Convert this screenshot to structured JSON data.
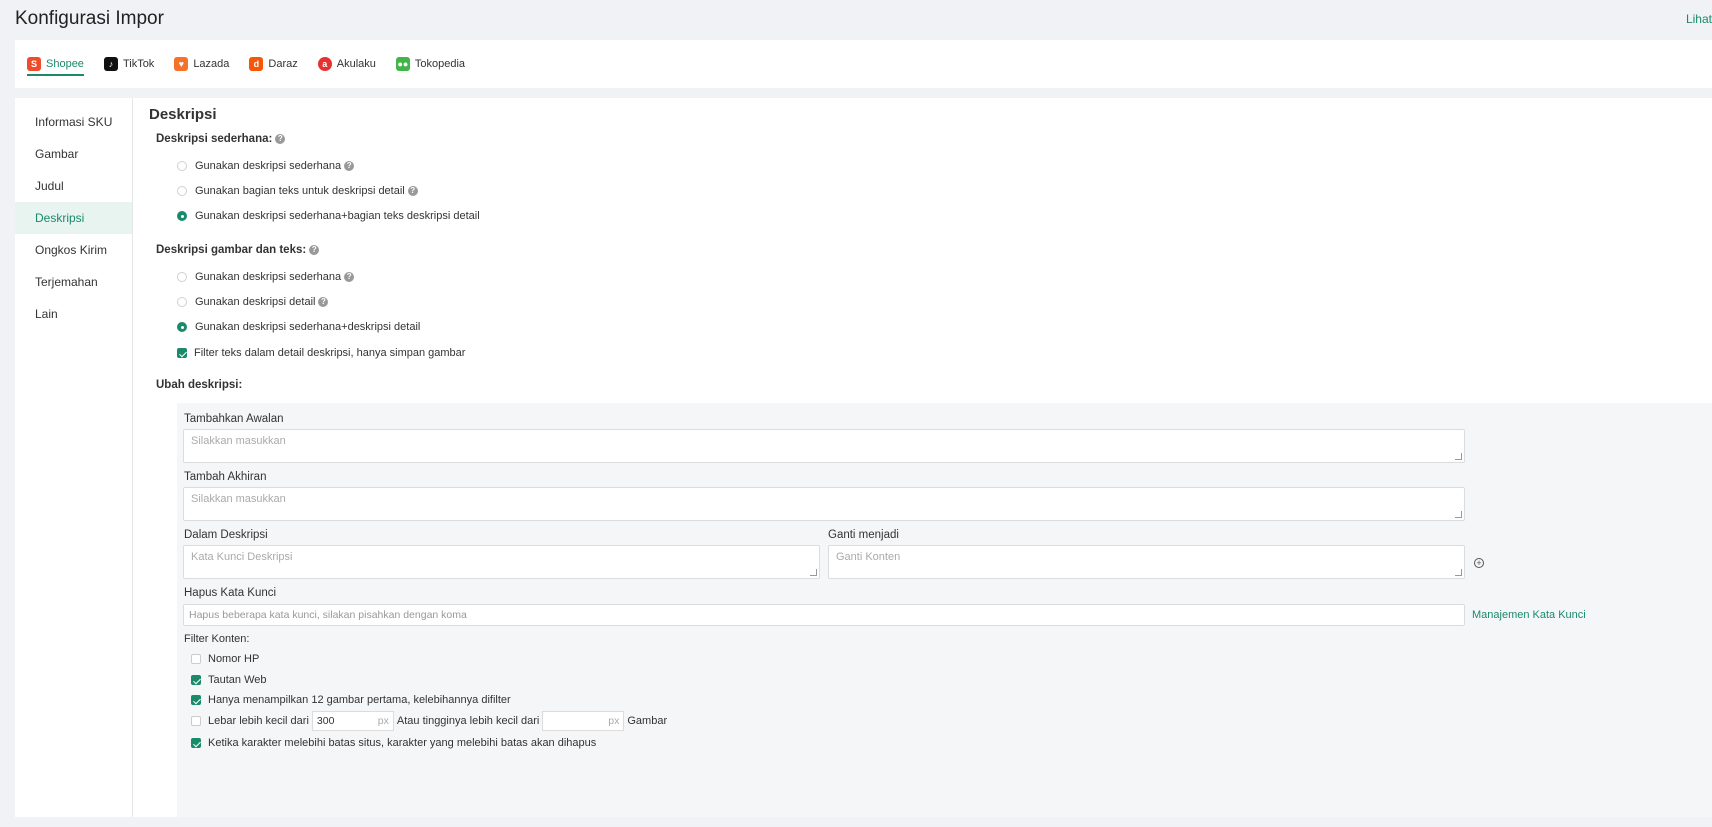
{
  "page": {
    "title": "Konfigurasi Impor",
    "top_link": "Lihat"
  },
  "tabs": [
    {
      "label": "Shopee",
      "icon": "shopee-icon",
      "color": "#ee4d2d"
    },
    {
      "label": "TikTok",
      "icon": "tiktok-icon",
      "color": "#111111"
    },
    {
      "label": "Lazada",
      "icon": "lazada-icon",
      "color": "#f5722b"
    },
    {
      "label": "Daraz",
      "icon": "daraz-icon",
      "color": "#f85606"
    },
    {
      "label": "Akulaku",
      "icon": "akulaku-icon",
      "color": "#e8312f"
    },
    {
      "label": "Tokopedia",
      "icon": "tokopedia-icon",
      "color": "#42b549"
    }
  ],
  "sidebar": {
    "items": [
      {
        "label": "Informasi SKU"
      },
      {
        "label": "Gambar"
      },
      {
        "label": "Judul"
      },
      {
        "label": "Deskripsi"
      },
      {
        "label": "Ongkos Kirim"
      },
      {
        "label": "Terjemahan"
      },
      {
        "label": "Lain"
      }
    ],
    "active": "Deskripsi"
  },
  "section": {
    "title": "Deskripsi",
    "simple": {
      "label": "Deskripsi sederhana:",
      "options": [
        {
          "label": "Gunakan deskripsi sederhana",
          "selected": false
        },
        {
          "label": "Gunakan bagian teks untuk deskripsi detail",
          "selected": false
        },
        {
          "label": "Gunakan deskripsi sederhana+bagian teks deskripsi detail",
          "selected": true
        }
      ]
    },
    "image_text": {
      "label": "Deskripsi gambar dan teks:",
      "options": [
        {
          "label": "Gunakan deskripsi sederhana",
          "selected": false
        },
        {
          "label": "Gunakan deskripsi detail",
          "selected": false
        },
        {
          "label": "Gunakan deskripsi sederhana+deskripsi detail",
          "selected": true
        }
      ],
      "filter_checkbox": {
        "label": "Filter teks dalam detail deskripsi, hanya simpan gambar",
        "checked": true
      }
    },
    "edit": {
      "label": "Ubah deskripsi:",
      "prefix": {
        "label": "Tambahkan Awalan",
        "placeholder": "Silakkan masukkan"
      },
      "suffix": {
        "label": "Tambah Akhiran",
        "placeholder": "Silakkan masukkan"
      },
      "in_desc": {
        "label": "Dalam Deskripsi",
        "placeholder": "Kata Kunci Deskripsi"
      },
      "replace": {
        "label": "Ganti menjadi",
        "placeholder": "Ganti Konten"
      },
      "delete_kw": {
        "label": "Hapus Kata Kunci",
        "placeholder": "Hapus beberapa kata kunci, silakan pisahkan dengan koma",
        "link": "Manajemen Kata Kunci"
      },
      "filter": {
        "label": "Filter Konten:",
        "items": [
          {
            "label": "Nomor HP",
            "checked": false
          },
          {
            "label": "Tautan Web",
            "checked": true
          },
          {
            "label": "Hanya menampilkan 12 gambar pertama, kelebihannya difilter",
            "checked": true
          }
        ],
        "size_rule": {
          "checked": false,
          "prefix": "Lebar lebih kecil dari",
          "width_value": "300",
          "unit": "px",
          "middle": "Atau tingginya lebih kecil dari",
          "height_value": "",
          "suffix": "Gambar"
        },
        "char_limit": {
          "label": "Ketika karakter melebihi batas situs, karakter yang melebihi batas akan dihapus",
          "checked": true
        }
      }
    }
  },
  "colors": {
    "accent": "#1a8a6b"
  }
}
